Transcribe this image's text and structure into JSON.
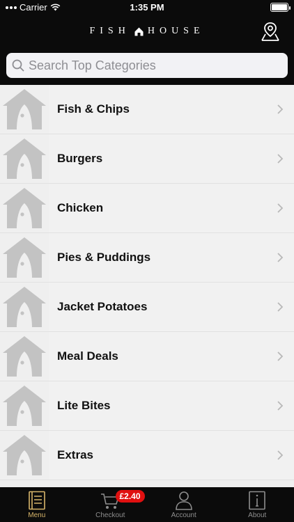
{
  "status_bar": {
    "carrier": "Carrier",
    "time": "1:35 PM"
  },
  "header": {
    "logo_left": "FISH",
    "logo_right": "HOUSE"
  },
  "search": {
    "placeholder": "Search Top Categories"
  },
  "categories": [
    {
      "label": "Fish & Chips"
    },
    {
      "label": "Burgers"
    },
    {
      "label": "Chicken"
    },
    {
      "label": "Pies & Puddings"
    },
    {
      "label": "Jacket Potatoes"
    },
    {
      "label": "Meal Deals"
    },
    {
      "label": "Lite Bites"
    },
    {
      "label": "Extras"
    }
  ],
  "tabs": {
    "menu": "Menu",
    "checkout": "Checkout",
    "checkout_badge": "£2.40",
    "account": "Account",
    "about": "About"
  },
  "colors": {
    "accent": "#d7b56a",
    "badge": "#e01010",
    "bar": "#0b0b0b"
  }
}
